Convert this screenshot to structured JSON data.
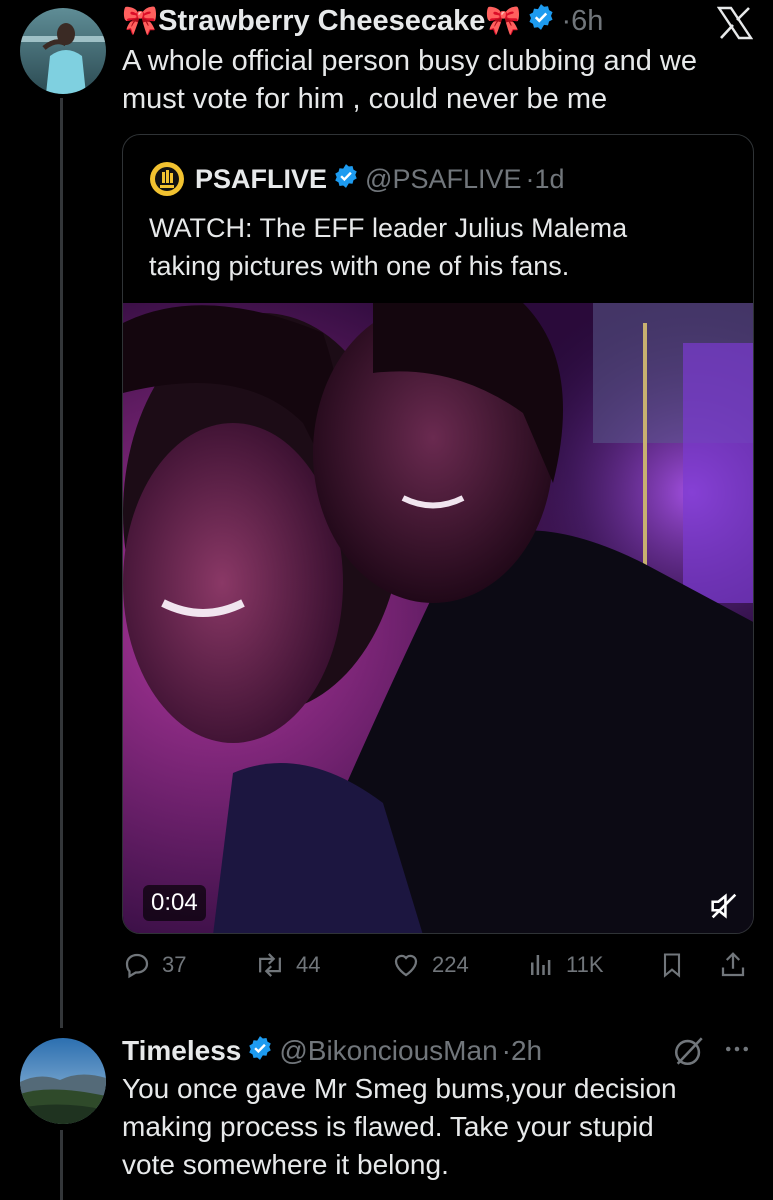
{
  "thread_color": "#333639",
  "verified_color": "#1d9bf0",
  "main_tweet": {
    "name": "🎀Strawberry Cheesecake🎀",
    "time": "·6h",
    "text_line1": "A whole official person busy clubbing and we",
    "text_line2": "must vote for him , could never be me"
  },
  "quote": {
    "name": "PSAFLIVE",
    "handle": "@PSAFLIVE",
    "time": "·1d",
    "text_line1": "WATCH: The EFF leader Julius Malema",
    "text_line2": "taking pictures with one of his fans.",
    "video_time": "0:04"
  },
  "actions": {
    "replies": "37",
    "reposts": "44",
    "likes": "224",
    "views": "11K"
  },
  "reply": {
    "name": "Timeless",
    "handle": "@BikonciousMan",
    "time": "·2h",
    "text_line1": "You once gave Mr Smeg bums,your decision",
    "text_line2": "making process is flawed. Take your stupid",
    "text_line3": "vote somewhere it belong."
  }
}
